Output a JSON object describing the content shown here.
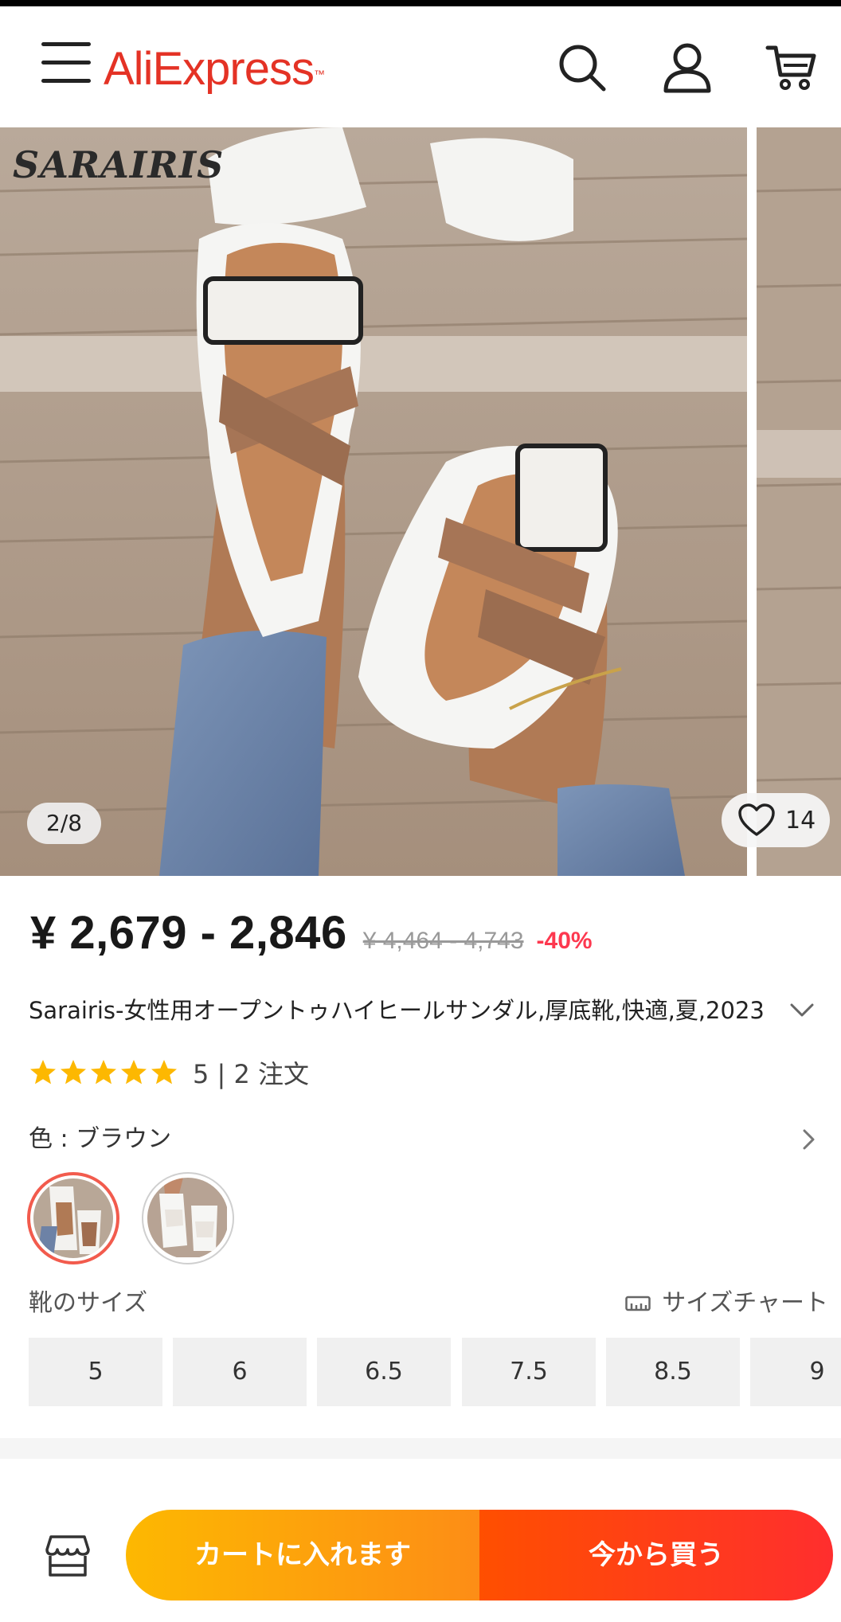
{
  "header": {
    "logo": "AliExpress",
    "icons": [
      "menu-icon",
      "search-icon",
      "account-icon",
      "cart-icon"
    ]
  },
  "gallery": {
    "brand_watermark": "SARAIRIS",
    "counter": "2/8",
    "wishlist_count": "14"
  },
  "product": {
    "price": "¥ 2,679 - 2,846",
    "original_price": "¥ 4,464 - 4,743",
    "discount": "-40%",
    "title": "Sarairis-女性用オープントゥハイヒールサンダル,厚底靴,快適,夏,2023",
    "rating_stars": 5,
    "rating_text": "5 | 2 注文"
  },
  "color": {
    "label": "色 : ブラウン",
    "options": [
      "brown",
      "white"
    ],
    "selected_index": 0
  },
  "size": {
    "label": "靴のサイズ",
    "chart_link": "サイズチャート",
    "options": [
      "5",
      "6",
      "6.5",
      "7.5",
      "8.5",
      "9"
    ]
  },
  "actions": {
    "add_to_cart": "カートに入れます",
    "buy_now": "今から買う"
  },
  "colors": {
    "brand": "#e43225",
    "cart_button_start": "#fdb801",
    "buy_button": "#ff3d1a",
    "discount": "#fd384f"
  }
}
